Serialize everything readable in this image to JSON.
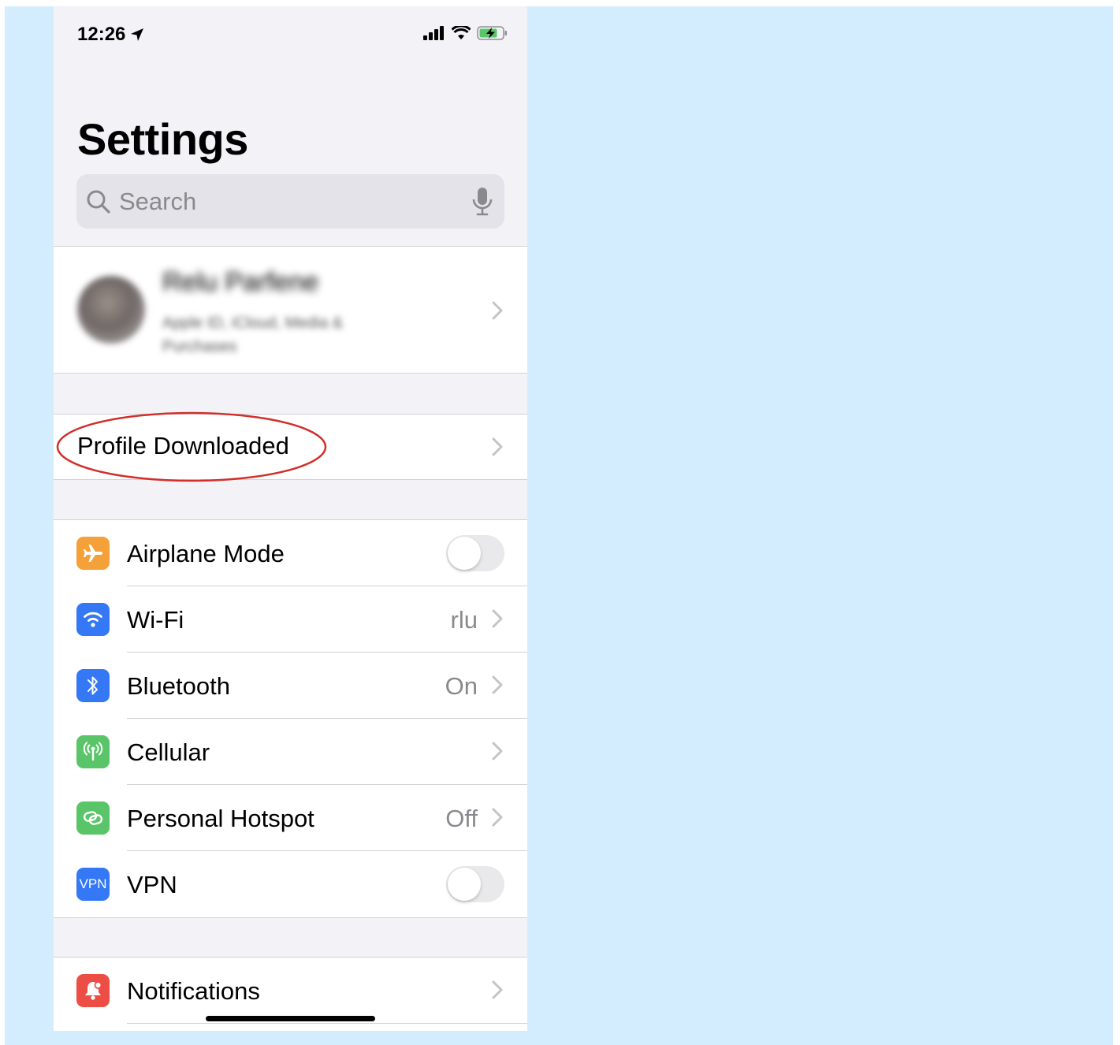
{
  "status_bar": {
    "time": "12:26"
  },
  "header": {
    "title": "Settings"
  },
  "search": {
    "placeholder": "Search"
  },
  "profile": {
    "name": "Relu Parfene",
    "subtitle": "Apple ID, iCloud, Media & Purchases"
  },
  "profile_downloaded": {
    "label": "Profile Downloaded"
  },
  "connectivity": {
    "items": [
      {
        "label": "Airplane Mode",
        "value": "",
        "control": "toggle",
        "on": false,
        "icon": "airplane-icon",
        "color": "#f4a13a"
      },
      {
        "label": "Wi-Fi",
        "value": "rlu",
        "control": "chevron",
        "icon": "wifi-icon",
        "color": "#3478f6"
      },
      {
        "label": "Bluetooth",
        "value": "On",
        "control": "chevron",
        "icon": "bluetooth-icon",
        "color": "#3478f6"
      },
      {
        "label": "Cellular",
        "value": "",
        "control": "chevron",
        "icon": "antenna-icon",
        "color": "#5ac568"
      },
      {
        "label": "Personal Hotspot",
        "value": "Off",
        "control": "chevron",
        "icon": "hotspot-icon",
        "color": "#5ac568"
      },
      {
        "label": "VPN",
        "value": "",
        "control": "toggle",
        "on": false,
        "icon": "vpn-icon",
        "icon_text": "VPN",
        "color": "#3478f6"
      }
    ]
  },
  "notifications": {
    "label": "Notifications",
    "color": "#ec4d45"
  },
  "colors": {
    "backdrop": "#d4edfe",
    "annotation": "#d0302b",
    "chevron": "#c4c4c7"
  }
}
